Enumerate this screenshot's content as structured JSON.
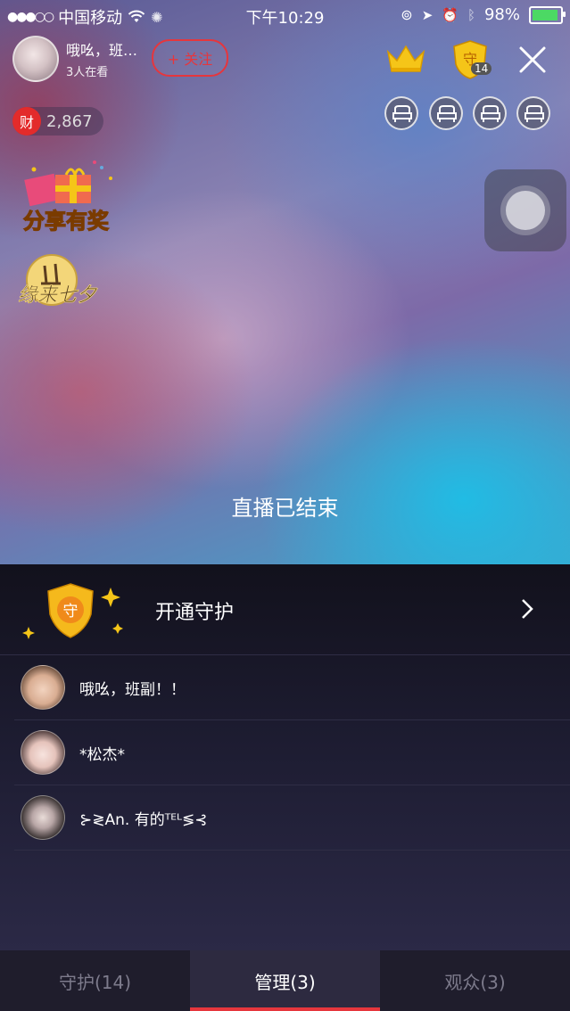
{
  "status_bar": {
    "carrier": "中国移动",
    "time": "下午10:29",
    "battery": "98%",
    "battery_level": 0.98,
    "icons": [
      "signal-dots-icon",
      "wifi-icon",
      "activity-icon",
      "orientation-lock-icon",
      "location-icon",
      "alarm-icon",
      "bluetooth-icon",
      "battery-icon"
    ]
  },
  "host": {
    "name": "哦吆，班…",
    "viewers": "3人在看",
    "follow_label": "+ 关注"
  },
  "top_right": {
    "guard_count": "14",
    "icons": [
      "crown-icon",
      "guard-shield-icon",
      "close-icon"
    ],
    "seats": [
      "seat-icon",
      "seat-icon",
      "seat-icon",
      "seat-icon"
    ]
  },
  "wealth": {
    "icon_label": "财",
    "value": "2,867"
  },
  "promos": {
    "share": "分享有奖",
    "qixi": "缘来七夕"
  },
  "live_status": "直播已结束",
  "guard_panel": {
    "open_label": "开通守护",
    "badge_char": "守"
  },
  "members": [
    {
      "name": "哦吆，班副！！"
    },
    {
      "name": "*松杰*"
    },
    {
      "name": "⊱≷An. 有的ᵀᴱᴸ≶⊰"
    }
  ],
  "tabs": [
    {
      "label": "守护(14)",
      "active": false
    },
    {
      "label": "管理(3)",
      "active": true
    },
    {
      "label": "观众(3)",
      "active": false
    }
  ],
  "colors": {
    "accent": "#e6363d",
    "gold": "#f5c518",
    "panel_bg": "#1d1c31"
  }
}
